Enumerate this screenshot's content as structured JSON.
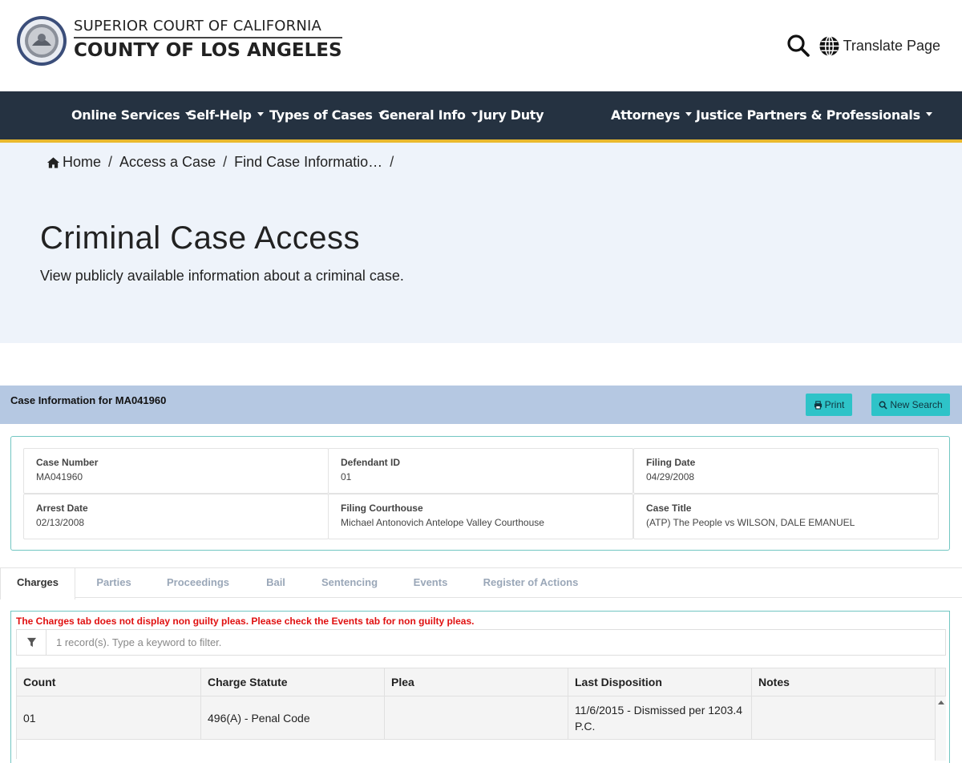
{
  "header": {
    "logo_line1": "SUPERIOR COURT OF CALIFORNIA",
    "logo_line2": "COUNTY OF LOS ANGELES",
    "seal_icon": "court-seal",
    "search_icon": "search-icon",
    "translate_label": "Translate Page"
  },
  "nav": {
    "items": [
      {
        "label": "Online Services"
      },
      {
        "label": "Self-Help"
      },
      {
        "label": "Types of Cases"
      },
      {
        "label": "General Info"
      },
      {
        "label": "Jury Duty"
      },
      {
        "label": "Attorneys"
      },
      {
        "label": "Justice Partners & Professionals"
      }
    ]
  },
  "breadcrumb": {
    "items": [
      "Home",
      "Access a Case",
      "Find Case Informatio…"
    ],
    "separator": "/"
  },
  "hero": {
    "title": "Criminal Case Access",
    "subtitle": "View publicly available information about a criminal case."
  },
  "case_bar": {
    "title": "Case Information for MA041960",
    "print_label": "Print",
    "new_search_label": "New Search"
  },
  "case_info": {
    "case_number": {
      "label": "Case Number",
      "value": "MA041960"
    },
    "defendant_id": {
      "label": "Defendant ID",
      "value": "01"
    },
    "filing_date": {
      "label": "Filing Date",
      "value": "04/29/2008"
    },
    "arrest_date": {
      "label": "Arrest Date",
      "value": "02/13/2008"
    },
    "filing_courthouse": {
      "label": "Filing Courthouse",
      "value": "Michael Antonovich Antelope Valley Courthouse"
    },
    "case_title": {
      "label": "Case Title",
      "value": "(ATP) The People vs WILSON, DALE EMANUEL"
    }
  },
  "tabs": [
    {
      "label": "Charges"
    },
    {
      "label": "Parties"
    },
    {
      "label": "Proceedings"
    },
    {
      "label": "Bail"
    },
    {
      "label": "Sentencing"
    },
    {
      "label": "Events"
    },
    {
      "label": "Register of Actions"
    }
  ],
  "charges": {
    "warning": "The Charges tab does not display non guilty pleas. Please check the Events tab for non guilty pleas.",
    "filter_placeholder": "1 record(s). Type a keyword to filter.",
    "columns": [
      "Count",
      "Charge Statute",
      "Plea",
      "Last Disposition",
      "Notes"
    ],
    "rows": [
      {
        "count": "01",
        "charge_statute": "496(A) - Penal Code",
        "plea": "",
        "last_disposition": "11/6/2015 - Dismissed per 1203.4 P.C.",
        "notes": ""
      }
    ]
  },
  "colors": {
    "nav_bg": "#253241",
    "nav_accent": "#e9b92d",
    "hero_bg": "#eef3fa",
    "case_bar_bg": "#b5c8e2",
    "button_bg": "#2ec3c8",
    "box_border": "#72c6c2",
    "warning_text": "#e01010"
  }
}
